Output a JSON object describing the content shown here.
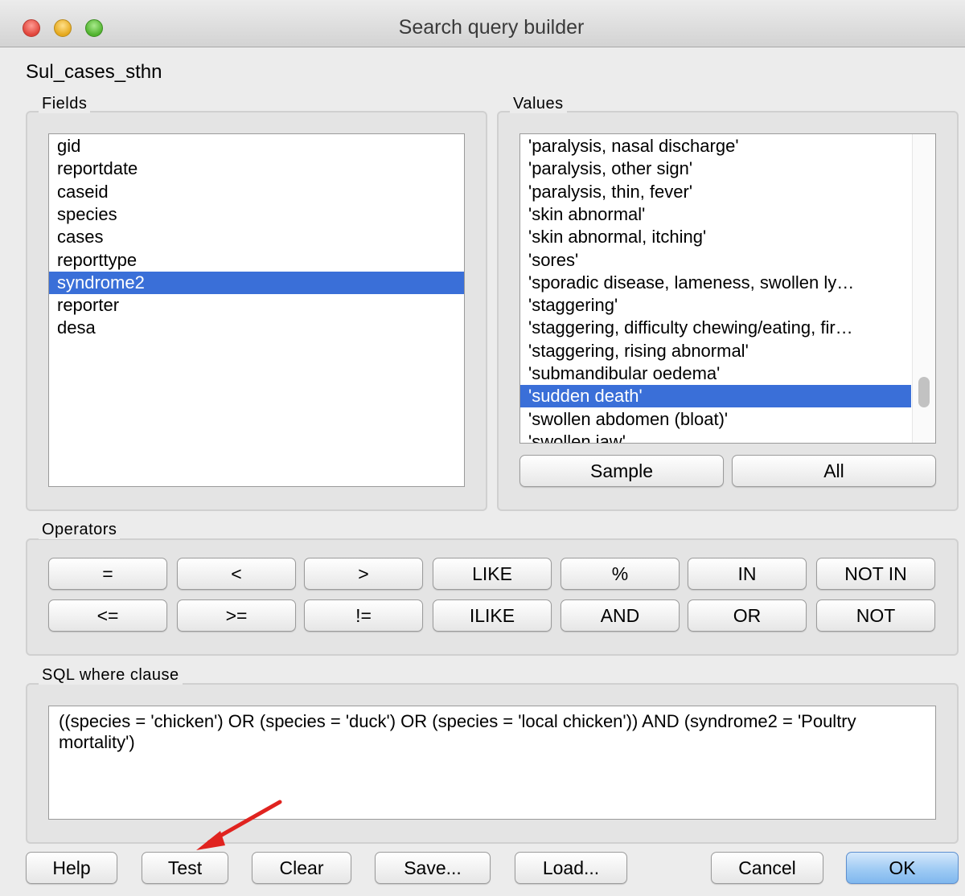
{
  "window": {
    "title": "Search query builder"
  },
  "layer_name": "Sul_cases_sthn",
  "fields": {
    "label": "Fields",
    "items": [
      "gid",
      "reportdate",
      "caseid",
      "species",
      "cases",
      "reporttype",
      "syndrome2",
      "reporter",
      "desa"
    ],
    "selected": "syndrome2"
  },
  "values": {
    "label": "Values",
    "items": [
      "'paralysis, nasal discharge'",
      "'paralysis, other sign'",
      "'paralysis, thin, fever'",
      "'skin abnormal'",
      "'skin abnormal, itching'",
      "'sores'",
      "'sporadic disease, lameness, swollen ly…",
      "'staggering'",
      "'staggering, difficulty chewing/eating, fir…",
      "'staggering, rising abnormal'",
      "'submandibular oedema'",
      "'sudden death'",
      "'swollen abdomen (bloat)'",
      "'swollen jaw'"
    ],
    "selected": "'sudden death'",
    "sample_label": "Sample",
    "all_label": "All"
  },
  "operators": {
    "label": "Operators",
    "row1": [
      "=",
      "<",
      ">",
      "LIKE",
      "%",
      "IN",
      "NOT IN"
    ],
    "row2": [
      "<=",
      ">=",
      "!=",
      "ILIKE",
      "AND",
      "OR",
      "NOT"
    ]
  },
  "sql": {
    "label": "SQL where clause",
    "text": "((species = 'chicken') OR (species = 'duck') OR (species = 'local chicken')) AND (syndrome2 = 'Poultry mortality')"
  },
  "footer": {
    "help_label": "Help",
    "test_label": "Test",
    "clear_label": "Clear",
    "save_label": "Save...",
    "load_label": "Load...",
    "cancel_label": "Cancel",
    "ok_label": "OK"
  },
  "colors": {
    "selection": "#3a6fd8",
    "annotation_arrow": "#e0231f",
    "ok_button": "#9fcbf4"
  }
}
